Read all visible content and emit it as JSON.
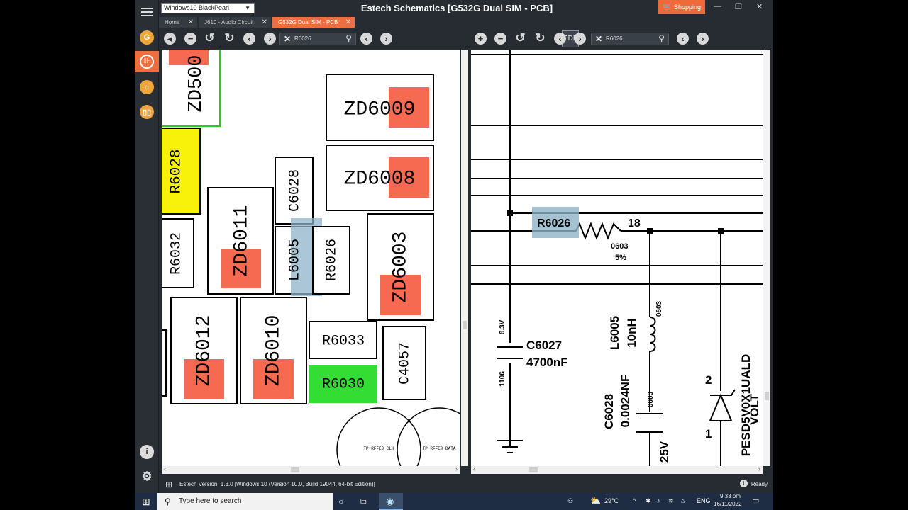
{
  "window": {
    "title": "Estech Schematics [G532G Dual SIM - PCB]",
    "selector": "Windows10 BlackPearl",
    "shopping_label": "Shopping",
    "controls": [
      "—",
      "❐",
      "✕"
    ]
  },
  "tabs": [
    {
      "label": "Home"
    },
    {
      "label": "J610 - Audio Circuit"
    },
    {
      "label": "G532G Dual SIM - PCB",
      "active": true
    }
  ],
  "left_search": {
    "value": "R6026"
  },
  "right_search": {
    "value": "R6026"
  },
  "pcb": {
    "components": [
      "ZD500",
      "ZD6009",
      "R6028",
      "ZD6008",
      "C6028",
      "R6032",
      "ZD6011",
      "L6005",
      "R6026",
      "ZD6003",
      "ZD6012",
      "ZD6010",
      "R6033",
      "C4057",
      "R6030"
    ],
    "test_points": [
      "TP_RFFE0_CLK",
      "TP_RFFE0_DATA"
    ]
  },
  "schematic": {
    "resistor": {
      "ref": "R6026",
      "net": "18",
      "package": "0603",
      "tolerance": "5%"
    },
    "capacitor1": {
      "ref": "C6027",
      "value": "4700nF",
      "voltage": "6.3V",
      "package": "1106"
    },
    "inductor": {
      "ref": "L6005",
      "value": "10nH",
      "package": "0603"
    },
    "capacitor2": {
      "ref": "C6028",
      "value": "0.0024NF",
      "voltage": "25V",
      "package": "0603"
    },
    "diode": {
      "ref": "PESD5V0X1UALD",
      "ref2": "VOLT",
      "pin1": "1",
      "pin2": "2"
    }
  },
  "status": {
    "version": "Estech Version: 1.3.0 [Windows 10 (Version 10.0, Build 19044, 64-bit Edition)]",
    "state": "Ready"
  },
  "taskbar": {
    "search_placeholder": "Type here to search",
    "weather": "29°C",
    "lang": "ENG",
    "time": "9:33 pm",
    "date": "16/11/2022"
  },
  "colors": {
    "accent": "#ef6e40",
    "highlight_yellow": "#f8f20a",
    "highlight_green": "#33dd33",
    "pad": "#f56a50",
    "select_blue": "#8fb3c8"
  }
}
